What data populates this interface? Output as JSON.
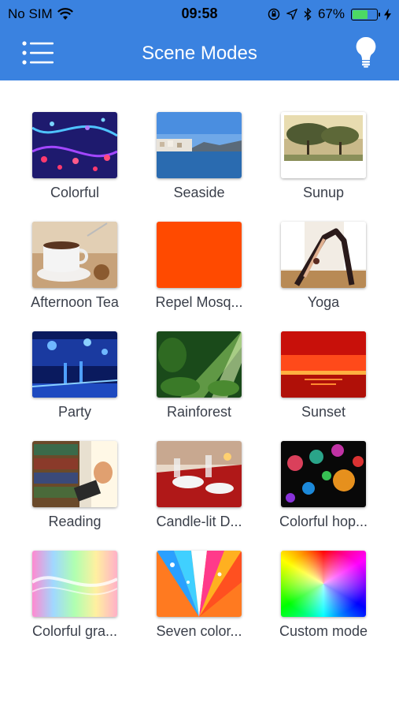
{
  "status_bar": {
    "carrier": "No SIM",
    "time": "09:58",
    "battery": "67%",
    "battery_level": 0.67
  },
  "header": {
    "title": "Scene Modes",
    "menu_icon": "menu-list-icon",
    "bulb_icon": "lightbulb-icon"
  },
  "scenes": [
    {
      "label": "Colorful",
      "image": "colorful-lights-image"
    },
    {
      "label": "Seaside",
      "image": "seaside-town-image"
    },
    {
      "label": "Sunup",
      "image": "sunrise-trees-image"
    },
    {
      "label": "Afternoon Tea",
      "image": "tea-cup-image"
    },
    {
      "label": "Repel Mosq...",
      "image": "orange-solid-image"
    },
    {
      "label": "Yoga",
      "image": "yoga-pose-image"
    },
    {
      "label": "Party",
      "image": "blue-party-image"
    },
    {
      "label": "Rainforest",
      "image": "rainforest-image"
    },
    {
      "label": "Sunset",
      "image": "red-sunset-image"
    },
    {
      "label": "Reading",
      "image": "library-reading-image"
    },
    {
      "label": "Candle-lit D...",
      "image": "candle-dinner-image"
    },
    {
      "label": "Colorful hop...",
      "image": "bokeh-lights-image"
    },
    {
      "label": "Colorful gra...",
      "image": "pastel-gradient-image"
    },
    {
      "label": "Seven color...",
      "image": "seven-color-rays-image"
    },
    {
      "label": "Custom mode",
      "image": "color-wheel-image"
    }
  ]
}
